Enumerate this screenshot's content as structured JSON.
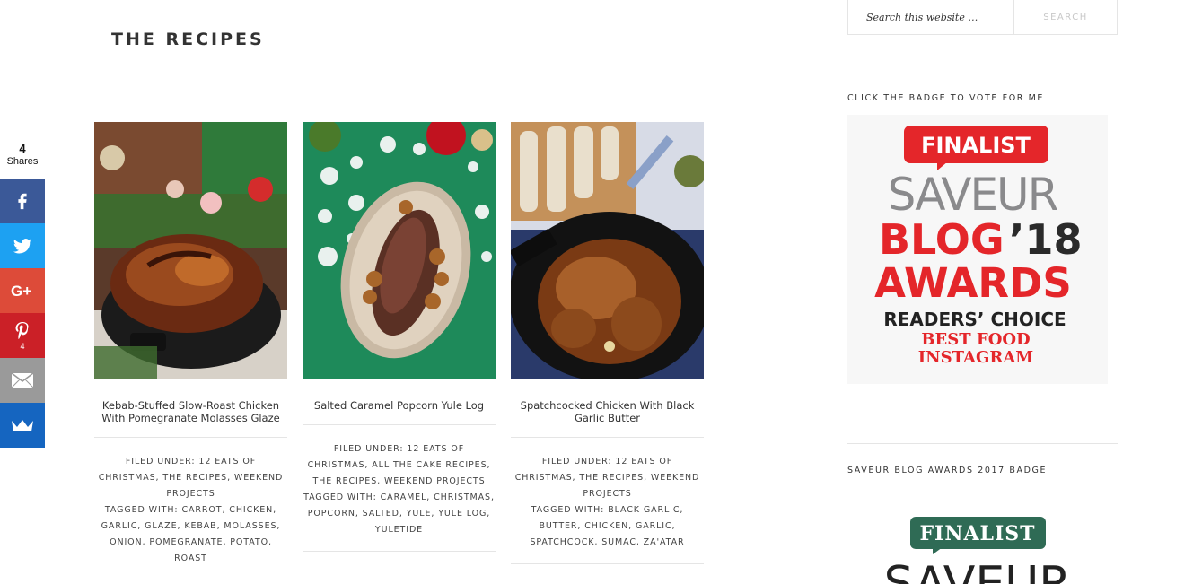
{
  "page": {
    "title": "THE RECIPES"
  },
  "share": {
    "count": "4",
    "count_label": "Shares",
    "buttons": [
      {
        "name": "facebook",
        "count": ""
      },
      {
        "name": "twitter",
        "count": ""
      },
      {
        "name": "google-plus",
        "count": ""
      },
      {
        "name": "pinterest",
        "count": "4"
      },
      {
        "name": "email",
        "count": ""
      },
      {
        "name": "sumome",
        "count": ""
      }
    ]
  },
  "recipes": [
    {
      "title": "Kebab-Stuffed Slow-Roast Chicken With Pomegranate Molasses Glaze",
      "filed_label": "FILED UNDER:",
      "filed": "12 EATS OF CHRISTMAS, THE RECIPES, WEEKEND PROJECTS",
      "tagged_label": "TAGGED WITH:",
      "tagged": "CARROT, CHICKEN, GARLIC, GLAZE, KEBAB, MOLASSES, ONION, POMEGRANATE, POTATO, ROAST"
    },
    {
      "title": "Salted Caramel Popcorn Yule Log",
      "filed_label": "FILED UNDER:",
      "filed": "12 EATS OF CHRISTMAS, ALL THE CAKE RECIPES, THE RECIPES, WEEKEND PROJECTS",
      "tagged_label": "TAGGED WITH:",
      "tagged": "CARAMEL, CHRISTMAS, POPCORN, SALTED, YULE, YULE LOG, YULETIDE"
    },
    {
      "title": "Spatchcocked Chicken With Black Garlic Butter",
      "filed_label": "FILED UNDER:",
      "filed": "12 EATS OF CHRISTMAS, THE RECIPES, WEEKEND PROJECTS",
      "tagged_label": "TAGGED WITH:",
      "tagged": "BLACK GARLIC, BUTTER, CHICKEN, GARLIC, SPATCHCOCK, SUMAC, ZA'ATAR"
    }
  ],
  "sidebar": {
    "search_placeholder": "Search this website …",
    "search_button": "SEARCH",
    "widget1_title": "CLICK THE BADGE TO VOTE FOR ME",
    "badge1": {
      "finalist": "FINALIST",
      "saveur": "SAVEUR",
      "blog": "BLOG",
      "year": "’18",
      "awards": "AWARDS",
      "readers_choice": "READERS’ CHOICE",
      "category1": "BEST FOOD",
      "category2": "INSTAGRAM"
    },
    "widget2_title": "SAVEUR BLOG AWARDS 2017 BADGE",
    "badge2": {
      "finalist": "FINALIST",
      "saveur": "SAVEUR"
    }
  },
  "colors": {
    "badge_red": "#e4262a",
    "badge_grey": "#8a8a8c",
    "badge_green": "#2f6b55",
    "facebook": "#3b5998",
    "twitter": "#1da1f2",
    "google_plus": "#dd4b39",
    "pinterest": "#cb2027",
    "email": "#9a9a9a",
    "sumome": "#1565c0"
  }
}
